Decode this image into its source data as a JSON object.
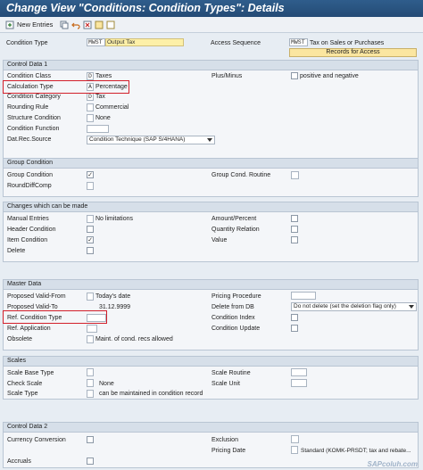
{
  "window": {
    "title": "Change View \"Conditions: Condition Types\": Details"
  },
  "toolbar": {
    "new_entries": "New Entries"
  },
  "header": {
    "condition_type_label": "Condition Type",
    "condition_type_code": "MWST",
    "condition_type_name": "Output Tax",
    "access_sequence_label": "Access Sequence",
    "access_sequence_code": "MWST",
    "access_sequence_name": "Tax on Sales or Purchases",
    "records_for_access_button": "Records for Access"
  },
  "control_data_1": {
    "title": "Control Data 1",
    "condition_class_label": "Condition Class",
    "condition_class_code": "D",
    "condition_class_text": "Taxes",
    "plus_minus_label": "Plus/Minus",
    "plus_minus_text": "positive and negative",
    "calculation_type_label": "Calculation Type",
    "calculation_type_code": "A",
    "calculation_type_text": "Percentage",
    "condition_category_label": "Condition Category",
    "condition_category_code": "D",
    "condition_category_text": "Tax",
    "rounding_rule_label": "Rounding Rule",
    "rounding_rule_text": "Commercial",
    "structure_condition_label": "Structure Condition",
    "structure_condition_text": "None",
    "condition_function_label": "Condition Function",
    "dat_rec_source_label": "Dat.Rec.Source",
    "dat_rec_source_value": "Condition Technique (SAP S/4HANA)"
  },
  "group_condition": {
    "title": "Group Condition",
    "group_condition_label": "Group Condition",
    "group_condition_checked": true,
    "group_cond_routine_label": "Group Cond. Routine",
    "round_diff_comp_label": "RoundDiffComp"
  },
  "changes": {
    "title": "Changes which can be made",
    "manual_entries_label": "Manual Entries",
    "manual_entries_text": "No limitations",
    "amount_percent_label": "Amount/Percent",
    "header_condition_label": "Header Condition",
    "quantity_relation_label": "Quantity Relation",
    "item_condition_label": "Item Condition",
    "item_condition_checked": true,
    "value_label": "Value",
    "delete_label": "Delete"
  },
  "master_data": {
    "title": "Master Data",
    "proposed_valid_from_label": "Proposed Valid-From",
    "proposed_valid_from_text": "Today's date",
    "pricing_procedure_label": "Pricing Procedure",
    "proposed_valid_to_label": "Proposed Valid-To",
    "proposed_valid_to_value": "31.12.9999",
    "delete_from_db_label": "Delete from DB",
    "delete_from_db_value": "Do not delete (set the deletion flag only)",
    "ref_condition_type_label": "Ref. Condition Type",
    "condition_index_label": "Condition Index",
    "ref_application_label": "Ref. Application",
    "condition_update_label": "Condition Update",
    "obsolete_label": "Obsolete",
    "obsolete_text": "Maint. of cond. recs allowed"
  },
  "scales": {
    "title": "Scales",
    "scale_base_type_label": "Scale Base Type",
    "scale_routine_label": "Scale Routine",
    "check_scale_label": "Check Scale",
    "check_scale_text": "None",
    "scale_unit_label": "Scale Unit",
    "scale_type_label": "Scale Type",
    "scale_type_text": "can be maintained in condition record"
  },
  "control_data_2": {
    "title": "Control Data 2",
    "currency_conversion_label": "Currency Conversion",
    "exclusion_label": "Exclusion",
    "pricing_date_label": "Pricing Date",
    "pricing_date_text": "Standard (KOMK-PRSDT; tax and rebate...",
    "accruals_label": "Accruals"
  },
  "watermark": "SAPcoluh.com",
  "colors": {
    "highlight": "#d21f2a",
    "title_bar": "#2f5d8c",
    "required_field": "#fdf0a8"
  }
}
